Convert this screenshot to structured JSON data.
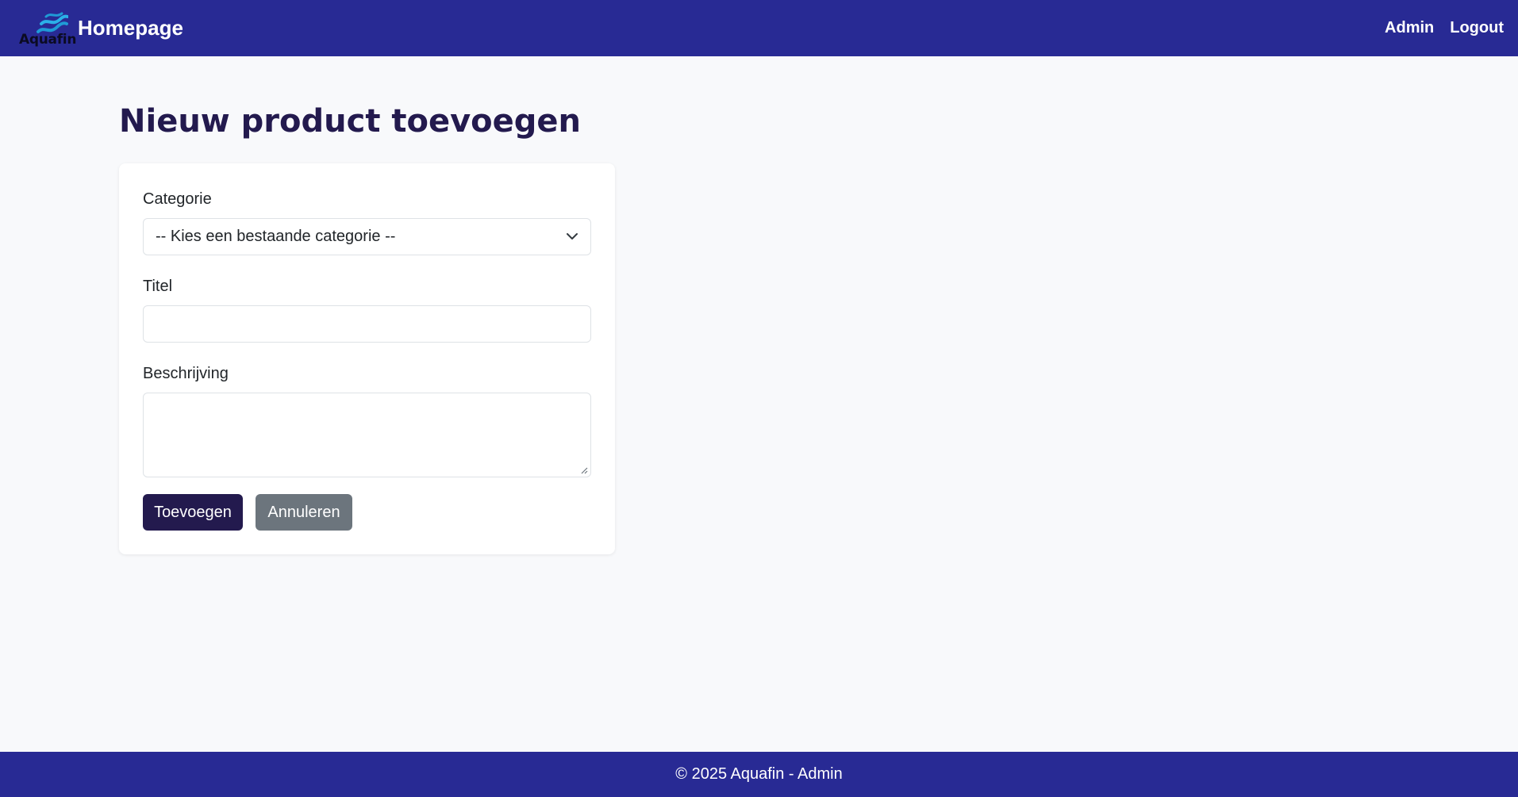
{
  "navbar": {
    "logo_text": "Aquafin",
    "brand_title": "Homepage",
    "links": [
      "Admin",
      "Logout"
    ]
  },
  "page": {
    "title": "Nieuw product toevoegen"
  },
  "form": {
    "category_label": "Categorie",
    "category_selected": "-- Kies een bestaande categorie --",
    "title_label": "Titel",
    "title_value": "",
    "description_label": "Beschrijving",
    "description_value": "",
    "submit_label": "Toevoegen",
    "cancel_label": "Annuleren"
  },
  "footer": {
    "text": "© 2025 Aquafin - Admin"
  },
  "colors": {
    "nav_bg": "#282a94",
    "primary": "#231a4e",
    "secondary": "#6c757d",
    "page_bg": "#f8f9fb",
    "logo_wave": "#1f9ad6"
  }
}
